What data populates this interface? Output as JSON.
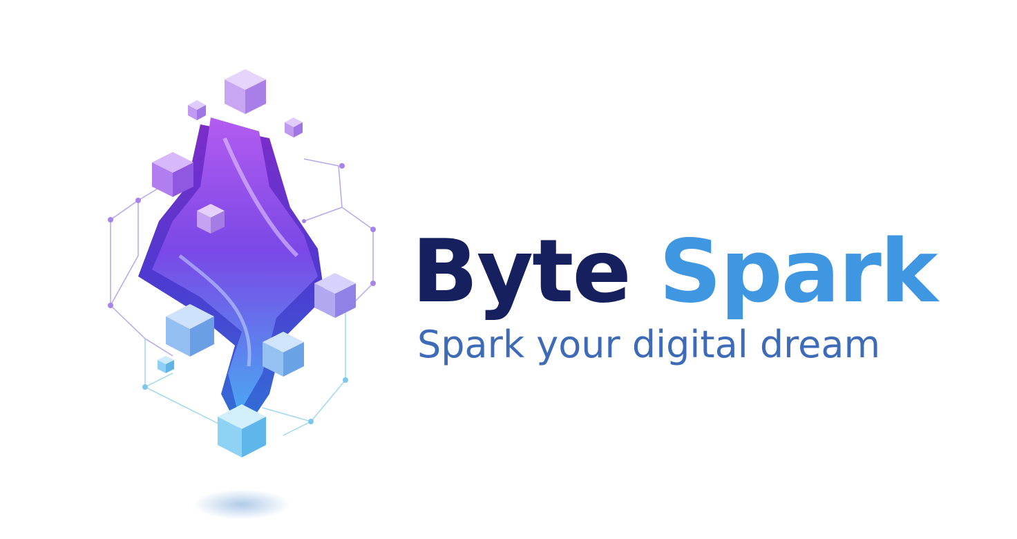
{
  "brand": {
    "word_1": "Byte",
    "word_2": "Spark",
    "tagline": "Spark your digital dream"
  },
  "colors": {
    "background": "#ffffff",
    "word_1": "#16205e",
    "word_2": "#3f97e2",
    "tagline": "#3e6bb8",
    "emblem_purple": "#9b3fe0",
    "emblem_blue": "#4a7ff0",
    "emblem_cyan": "#5fc3f0"
  },
  "icons": {
    "emblem": "isometric-cube-s-logo-icon"
  }
}
